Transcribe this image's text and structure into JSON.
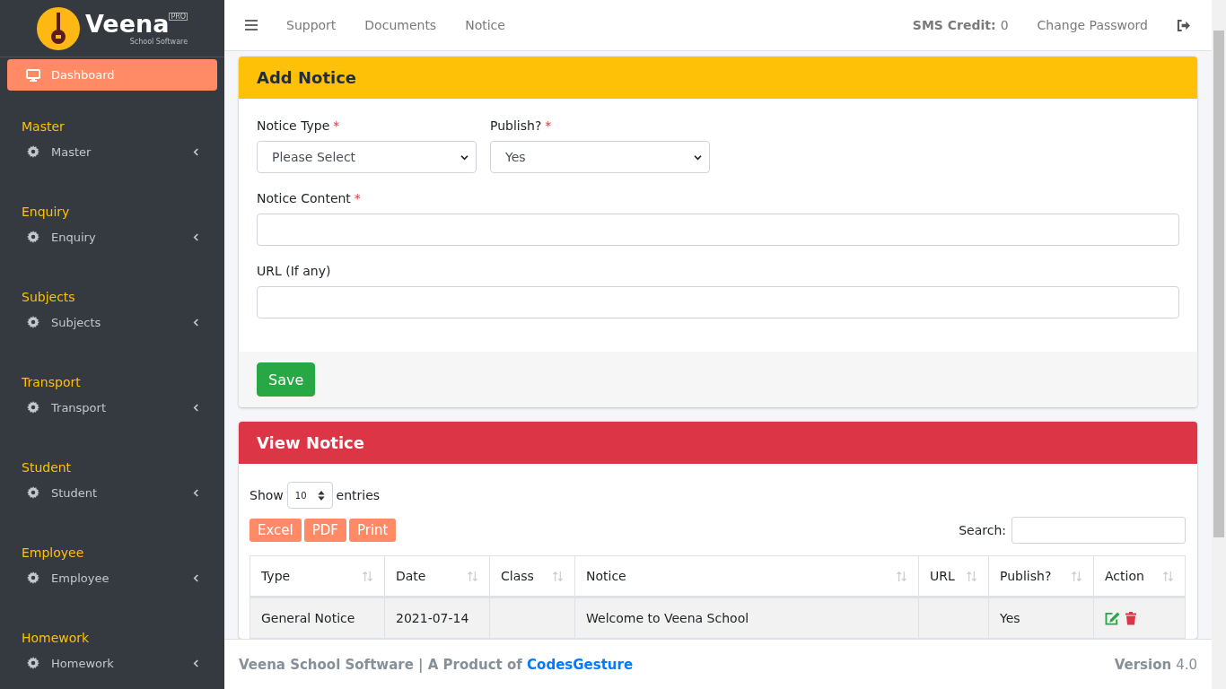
{
  "brand": {
    "name": "Veena",
    "badge": "PRO",
    "tagline": "School Software"
  },
  "sidebar": {
    "items": [
      {
        "label": "Dashboard",
        "selected": true
      }
    ],
    "sections": [
      {
        "heading": "Master",
        "items": [
          {
            "label": "Master",
            "expanded": false
          }
        ]
      },
      {
        "heading": "Enquiry",
        "items": [
          {
            "label": "Enquiry",
            "expanded": false
          }
        ]
      },
      {
        "heading": "Subjects",
        "items": [
          {
            "label": "Subjects",
            "expanded": false
          }
        ]
      },
      {
        "heading": "Transport",
        "items": [
          {
            "label": "Transport",
            "expanded": false
          }
        ]
      },
      {
        "heading": "Student",
        "items": [
          {
            "label": "Student",
            "expanded": false
          }
        ]
      },
      {
        "heading": "Employee",
        "items": [
          {
            "label": "Employee",
            "expanded": false
          }
        ]
      },
      {
        "heading": "Homework",
        "items": [
          {
            "label": "Homework",
            "expanded": false
          }
        ]
      }
    ]
  },
  "navbar": {
    "links": [
      "Support",
      "Documents",
      "Notice"
    ],
    "sms_label": "SMS Credit:",
    "sms_value": "0",
    "change_password": "Change Password"
  },
  "add_notice": {
    "title": "Add Notice",
    "required_mark": "*",
    "fields": [
      {
        "kind": "select",
        "label": "Notice Type",
        "required": true,
        "value": "Please Select"
      },
      {
        "kind": "select",
        "label": "Publish?",
        "required": true,
        "value": "Yes"
      },
      {
        "kind": "text",
        "label": "Notice Content",
        "required": true
      },
      {
        "kind": "text",
        "label": "URL (If any)",
        "required": false
      }
    ],
    "save": "Save"
  },
  "view_notice": {
    "title": "View Notice",
    "show_label": "Show",
    "page_length": "10",
    "entries_label": "entries",
    "buttons": [
      "Excel",
      "PDF",
      "Print"
    ],
    "search_label": "Search:",
    "table": {
      "columns": [
        {
          "label": "Type"
        },
        {
          "label": "Date"
        },
        {
          "label": "Class"
        },
        {
          "label": "Notice"
        },
        {
          "label": "URL"
        },
        {
          "label": "Publish?"
        },
        {
          "label": "Action"
        }
      ],
      "rows": [
        {
          "type": "General Notice",
          "date": "2021-07-14",
          "notice": "Welcome to Veena School",
          "publish": "Yes"
        }
      ]
    }
  },
  "footer": {
    "text": "Veena School Software | A Product of ",
    "link": "CodesGesture",
    "version_label": "Version",
    "version": "4.0"
  }
}
